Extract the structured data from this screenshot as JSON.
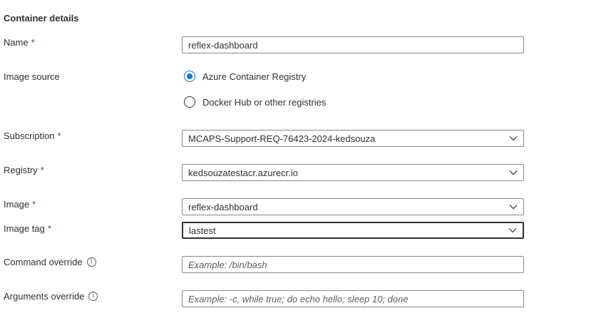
{
  "section": {
    "title": "Container details"
  },
  "fields": {
    "name": {
      "label": "Name",
      "required": "*",
      "value": "reflex-dashboard"
    },
    "image_source": {
      "label": "Image source",
      "options": [
        "Azure Container Registry",
        "Docker Hub or other registries"
      ],
      "selected": "Azure Container Registry"
    },
    "subscription": {
      "label": "Subscription",
      "required": "*",
      "value": "MCAPS-Support-REQ-76423-2024-kedsouza"
    },
    "registry": {
      "label": "Registry",
      "required": "*",
      "value": "kedsouzatestacr.azurecr.io"
    },
    "image": {
      "label": "Image",
      "required": "*",
      "value": "reflex-dashboard"
    },
    "image_tag": {
      "label": "Image tag",
      "required": "*",
      "value": "lastest"
    },
    "command_override": {
      "label": "Command override",
      "placeholder": "Example: /bin/bash"
    },
    "arguments_override": {
      "label": "Arguments override",
      "placeholder": "Example: -c, while true; do echo hello; sleep 10; done"
    }
  },
  "icons": {
    "info": "info-icon",
    "dropdown": "chevron-down-icon"
  },
  "colors": {
    "accent": "#0078d4",
    "required": "#a4262c",
    "border": "#8a8886",
    "text": "#323130"
  }
}
